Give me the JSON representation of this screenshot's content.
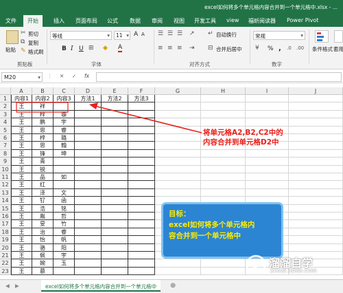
{
  "window": {
    "title": "excel如何将多个单元格内容合并到一个单元格中.xlsx - ..."
  },
  "tabs": [
    "文件",
    "开始",
    "插入",
    "页面布局",
    "公式",
    "数据",
    "审阅",
    "视图",
    "开发工具",
    "view",
    "福昕阅读器",
    "Power Pivot"
  ],
  "active_tab": "开始",
  "ribbon": {
    "paste": "粘贴",
    "cut": "剪切",
    "copy": "复制",
    "format_painter": "格式刷",
    "clipboard": "剪贴板",
    "font_name": "等线",
    "font_size": "11",
    "font": "字体",
    "bold": "B",
    "italic": "I",
    "underline": "U",
    "wrap_text": "自动换行",
    "merge_center": "合并后居中",
    "alignment": "对齐方式",
    "number_format": "常规",
    "percent": "%",
    "comma": ",",
    "number": "数字",
    "conditional_format": "条件格式",
    "format_as_table": "套用表格格式",
    "grow_font": "A",
    "shrink_font": "A",
    "font_color_letter": "A"
  },
  "formula_bar": {
    "name_box": "M20",
    "cancel": "✕",
    "enter": "✓",
    "fx": "fx",
    "formula": ""
  },
  "columns": [
    "A",
    "B",
    "C",
    "D",
    "E",
    "F",
    "G",
    "H",
    "I",
    "J"
  ],
  "rows": [
    [
      "内容1",
      "内容2",
      "内容3",
      "方法1",
      "方法2",
      "方法3"
    ],
    [
      "王",
      "祥",
      "",
      "",
      "",
      ""
    ],
    [
      "王",
      "梓",
      "璇",
      "",
      "",
      ""
    ],
    [
      "王",
      "鹏",
      "宇",
      "",
      "",
      ""
    ],
    [
      "王",
      "思",
      "睿",
      "",
      "",
      ""
    ],
    [
      "王",
      "梓",
      "璐",
      "",
      "",
      ""
    ],
    [
      "王",
      "思",
      "翰",
      "",
      "",
      ""
    ],
    [
      "王",
      "锋",
      "坤",
      "",
      "",
      ""
    ],
    [
      "王",
      "青",
      "",
      "",
      "",
      ""
    ],
    [
      "王",
      "锐",
      "",
      "",
      "",
      ""
    ],
    [
      "王",
      "品",
      "如",
      "",
      "",
      ""
    ],
    [
      "王",
      "红",
      "",
      "",
      "",
      ""
    ],
    [
      "王",
      "泽",
      "文",
      "",
      "",
      ""
    ],
    [
      "王",
      "钌",
      "函",
      "",
      "",
      ""
    ],
    [
      "王",
      "浩",
      "铭",
      "",
      "",
      ""
    ],
    [
      "王",
      "胤",
      "哲",
      "",
      "",
      ""
    ],
    [
      "王",
      "旻",
      "竹",
      "",
      "",
      ""
    ],
    [
      "王",
      "治",
      "睿",
      "",
      "",
      ""
    ],
    [
      "王",
      "怡",
      "帆",
      "",
      "",
      ""
    ],
    [
      "王",
      "骆",
      "阳",
      "",
      "",
      ""
    ],
    [
      "王",
      "佩",
      "宇",
      "",
      "",
      ""
    ],
    [
      "王",
      "婉",
      "玉",
      "",
      "",
      ""
    ],
    [
      "王",
      "慕",
      "",
      "",
      "",
      ""
    ]
  ],
  "annotation": {
    "line1": "将单元格A2,B2,C2中的",
    "line2": "内容合并到单元格D2中"
  },
  "goal": {
    "title": "目标：",
    "line1": "excel如何将多个单元格内",
    "line2": "容合并到一个单元格中"
  },
  "sheet_tab": "excel如何将多个单元格内容合并到一个单元格中",
  "watermark": {
    "brand": "溜溜自学",
    "url": "ZIXUE.3D66.COM"
  },
  "colors": {
    "excel_green": "#217346",
    "annotation_red": "#e8211b",
    "goal_blue": "#2c85d2",
    "goal_text": "#ffeb00"
  }
}
